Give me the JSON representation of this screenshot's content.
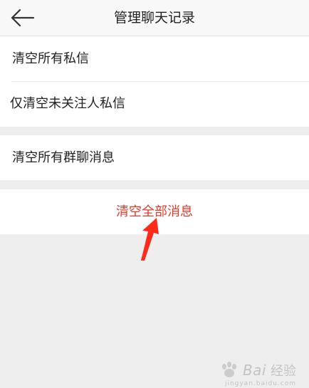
{
  "header": {
    "title": "管理聊天记录",
    "back_icon": "arrow-left-icon"
  },
  "options": {
    "clear_all_private": "清空所有私信",
    "clear_unfollowed_private": "仅清空未关注人私信",
    "clear_all_group": "清空所有群聊消息"
  },
  "danger": {
    "clear_all_messages": "清空全部消息"
  },
  "annotation": {
    "arrow_color": "#ff2a1a"
  },
  "watermark": {
    "logo": "Bai",
    "brand": "经验",
    "sub": "jingyan.baidu.com"
  },
  "colors": {
    "danger": "#e03c2c",
    "text": "#222222",
    "background": "#eeeeee",
    "header_bg": "#f8f8f8"
  }
}
